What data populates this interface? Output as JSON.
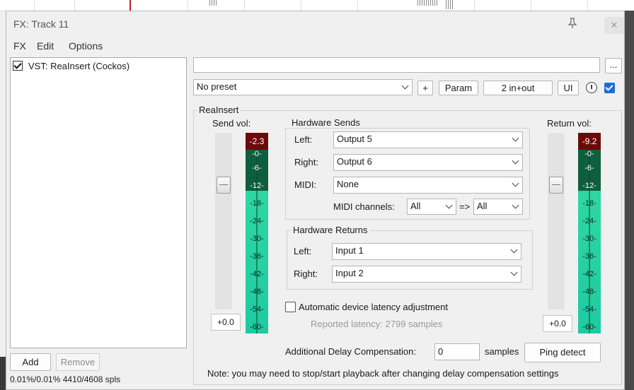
{
  "window": {
    "title": "FX: Track 11",
    "close_glyph": "✕",
    "pin_glyph": "📌"
  },
  "menu": [
    "FX",
    "Edit",
    "Options"
  ],
  "fx_chain": {
    "items": [
      {
        "label": "VST: ReaInsert (Cockos)",
        "enabled": true
      }
    ],
    "add_label": "Add",
    "remove_label": "Remove",
    "cpu_status": "0.01%/0.01% 4410/4608 spls"
  },
  "toolbar": {
    "preset": "No preset",
    "plus_label": "+",
    "param_label": "Param",
    "io_label": "2 in+out",
    "ui_label": "UI",
    "more_label": "..."
  },
  "plugin": {
    "name": "ReaInsert",
    "send_vol_label": "Send vol:",
    "return_vol_label": "Return vol:",
    "send_vol_value": "+0.0",
    "return_vol_value": "+0.0",
    "send_meter": {
      "peak": "-2.3",
      "ticks": [
        "-0-",
        "-6-",
        "-12-",
        "-18-",
        "-24-",
        "-30-",
        "-36-",
        "-42-",
        "-48-",
        "-54-",
        "-60-"
      ]
    },
    "return_meter": {
      "peak": "-9.2",
      "ticks": [
        "-0-",
        "-6-",
        "-12-",
        "-18-",
        "-24-",
        "-30-",
        "-36-",
        "-42-",
        "-48-",
        "-54-",
        "-60-"
      ]
    },
    "hardware_sends": {
      "title": "Hardware Sends",
      "left_label": "Left:",
      "left_value": "Output 5",
      "right_label": "Right:",
      "right_value": "Output 6",
      "midi_label": "MIDI:",
      "midi_value": "None",
      "midi_channels_label": "MIDI channels:",
      "midi_from": "All",
      "midi_arrow": "=>",
      "midi_to": "All"
    },
    "hardware_returns": {
      "title": "Hardware Returns",
      "left_label": "Left:",
      "left_value": "Input 1",
      "right_label": "Right:",
      "right_value": "Input 2"
    },
    "auto_latency_label": "Automatic device latency adjustment",
    "reported_latency": "Reported latency: 2799 samples",
    "delay_comp_label": "Additional Delay Compensation:",
    "delay_comp_value": "0",
    "samples_label": "samples",
    "ping_label": "Ping detect",
    "note": "Note: you may need to stop/start playback after changing delay compensation settings"
  }
}
